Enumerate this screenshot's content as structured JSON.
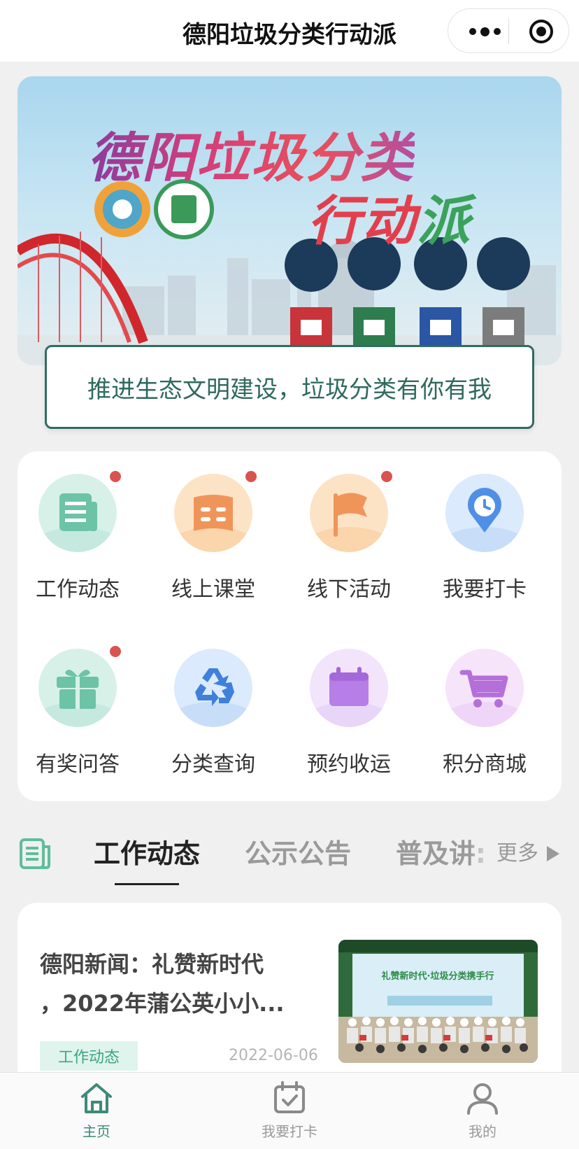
{
  "nav": {
    "title": "德阳垃圾分类行动派"
  },
  "banner": {
    "title_line1": "德阳垃圾分类",
    "title_line2_a": "行动",
    "title_line2_b": "派",
    "slogan": "推进生态文明建设，垃圾分类有你有我"
  },
  "grid": [
    {
      "label": "工作动态",
      "icon": "news-icon",
      "badge": true
    },
    {
      "label": "线上课堂",
      "icon": "book-icon",
      "badge": true
    },
    {
      "label": "线下活动",
      "icon": "flag-icon",
      "badge": true
    },
    {
      "label": "我要打卡",
      "icon": "location-clock-icon",
      "badge": false
    },
    {
      "label": "有奖问答",
      "icon": "gift-icon",
      "badge": true
    },
    {
      "label": "分类查询",
      "icon": "recycle-icon",
      "badge": false
    },
    {
      "label": "预约收运",
      "icon": "calendar-icon",
      "badge": false
    },
    {
      "label": "积分商城",
      "icon": "cart-icon",
      "badge": false
    }
  ],
  "tabs": {
    "items": [
      "工作动态",
      "公示公告",
      "普及讲:"
    ],
    "active_index": 0,
    "more": "更多"
  },
  "news": {
    "title_line1": "德阳新闻：礼赞新时代",
    "title_line2": "，2022年蒲公英小小...",
    "tag": "工作动态",
    "date": "2022-06-06",
    "thumb_caption": "礼赞新时代·垃圾分类携手行"
  },
  "bottom_bar": [
    {
      "label": "主页",
      "icon": "home-icon",
      "active": true
    },
    {
      "label": "我要打卡",
      "icon": "calendar-check-icon",
      "active": false
    },
    {
      "label": "我的",
      "icon": "user-icon",
      "active": false
    }
  ],
  "colors": {
    "accent": "#3e8a78",
    "badge": "#d9534f",
    "slogan_border": "#336b61"
  }
}
